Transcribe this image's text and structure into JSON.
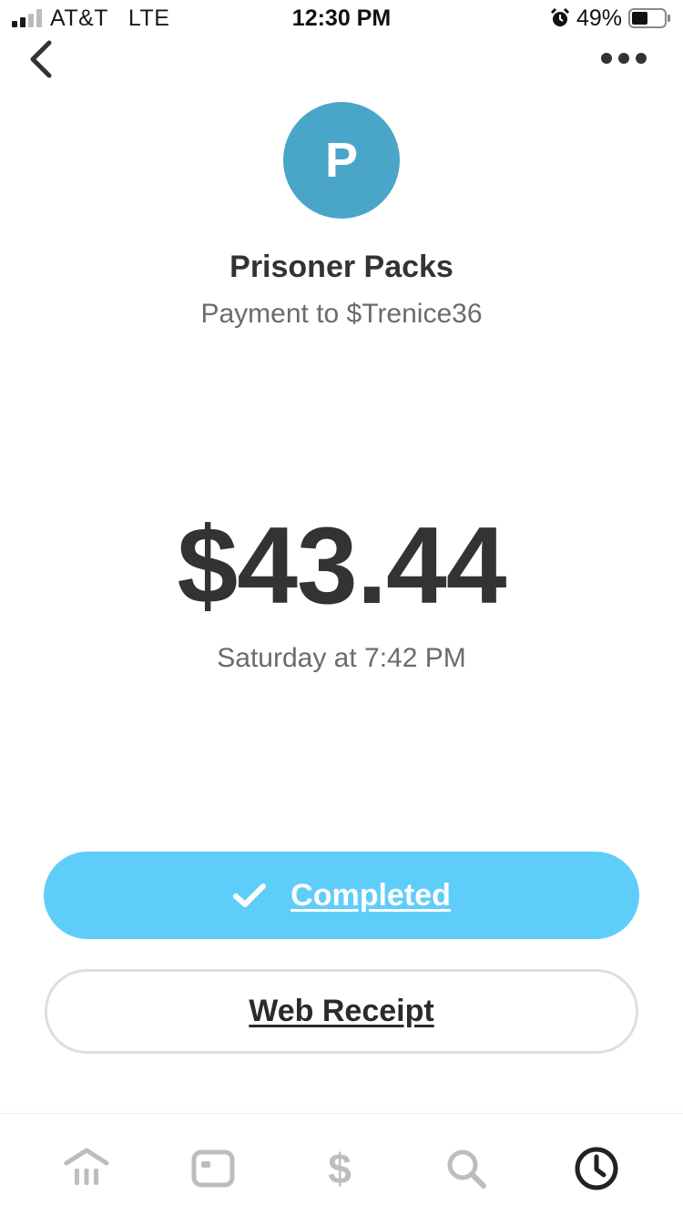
{
  "status_bar": {
    "carrier": "AT&T   LTE",
    "time": "12:30 PM",
    "battery": "49%",
    "signal_bars": 2,
    "battery_level": 0.49,
    "icons": [
      "signal-icon",
      "alarm-icon",
      "battery-icon"
    ]
  },
  "nav": {
    "back_icon": "chevron-left-icon",
    "more_icon": "ellipsis-icon"
  },
  "recipient": {
    "initial": "P",
    "name": "Prisoner Packs",
    "subtitle": "Payment to $Trenice36",
    "avatar_color": "#4aa6c8"
  },
  "payment": {
    "amount": "$43.44",
    "date": "Saturday at 7:42 PM"
  },
  "actions": {
    "completed_label": "Completed",
    "web_receipt_label": "Web Receipt",
    "completed_color": "#5fcdf9"
  },
  "tab_bar": {
    "items": [
      {
        "icon": "bank-icon",
        "active": false
      },
      {
        "icon": "card-icon",
        "active": false
      },
      {
        "icon": "dollar-icon",
        "glyph": "$",
        "active": false
      },
      {
        "icon": "search-icon",
        "active": false
      },
      {
        "icon": "clock-icon",
        "active": true
      }
    ]
  }
}
